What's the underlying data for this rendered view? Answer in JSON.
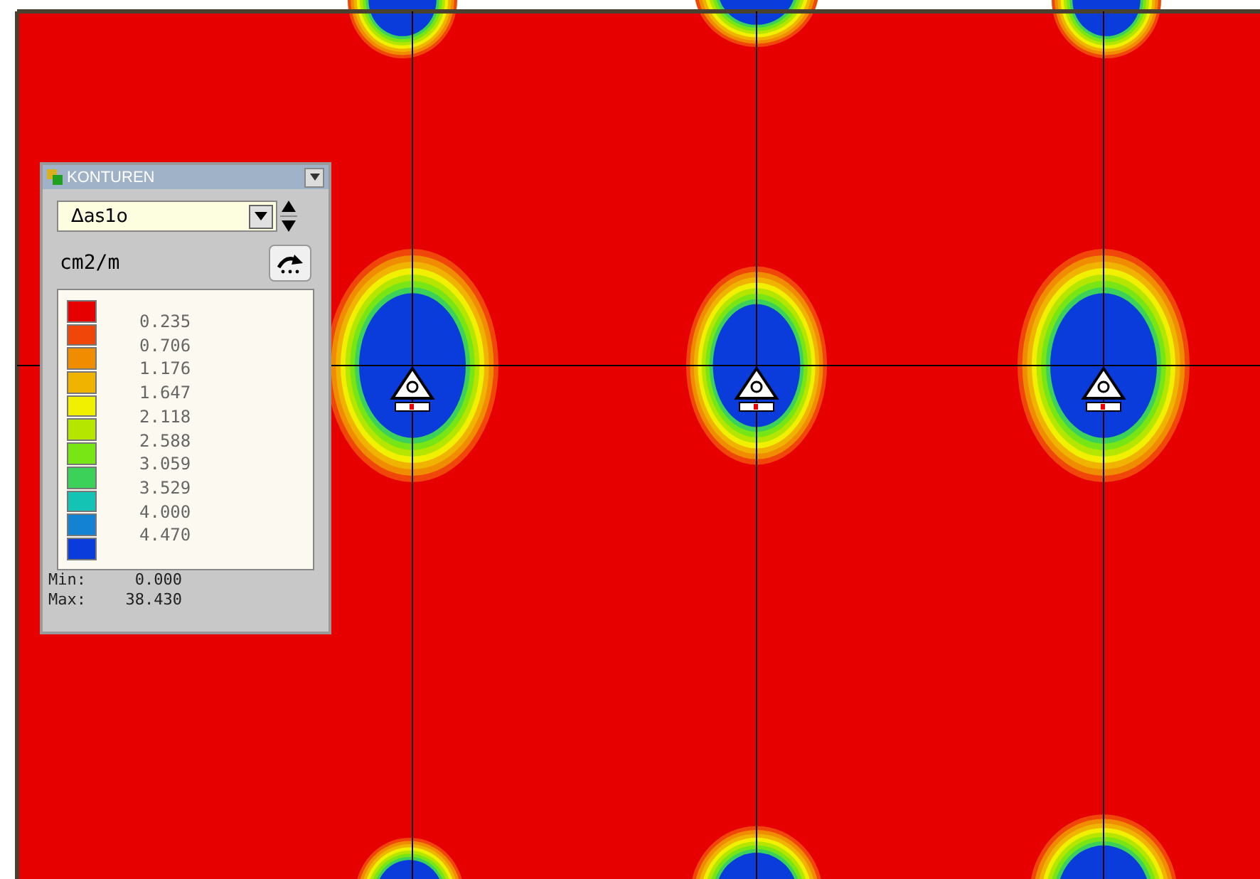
{
  "panel": {
    "title": "KONTUREN",
    "result": "Δas1o",
    "unit": "cm2/m",
    "levels": [
      {
        "color": "#e60000",
        "value": "0.235"
      },
      {
        "color": "#f0460a",
        "value": "0.706"
      },
      {
        "color": "#f08c00",
        "value": "1.176"
      },
      {
        "color": "#f0b400",
        "value": "1.647"
      },
      {
        "color": "#f0f000",
        "value": "2.118"
      },
      {
        "color": "#b4e600",
        "value": "2.588"
      },
      {
        "color": "#78e614",
        "value": "3.059"
      },
      {
        "color": "#3cd25a",
        "value": "3.529"
      },
      {
        "color": "#14c3b4",
        "value": "4.000"
      },
      {
        "color": "#1482d2",
        "value": "4.470"
      },
      {
        "color": "#0a3cdc"
      }
    ],
    "min_label": "Min:",
    "min": "0.000",
    "max_label": "Max:",
    "max": "38.430"
  }
}
